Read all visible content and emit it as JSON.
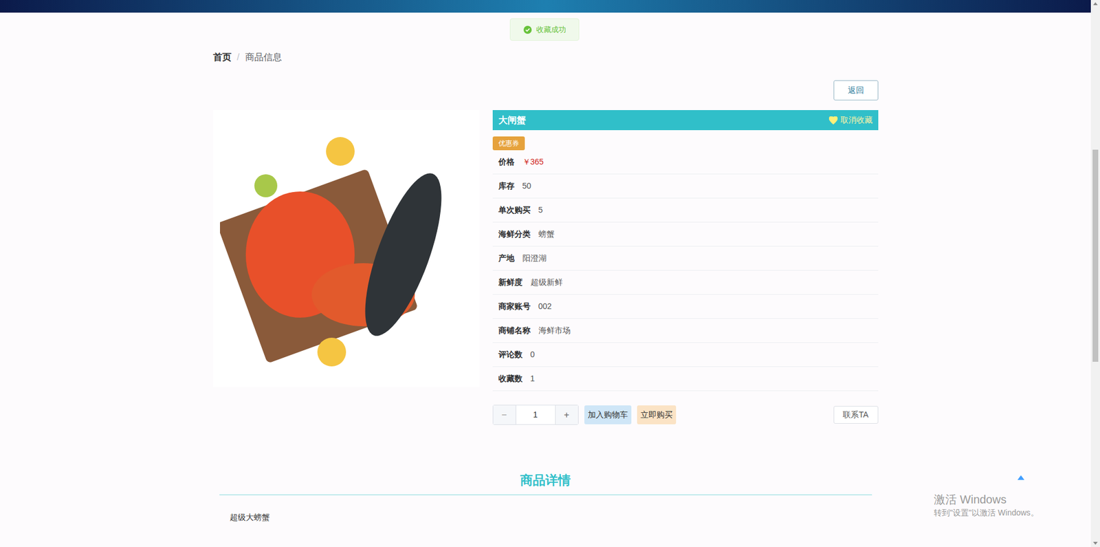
{
  "toast": {
    "text": "收藏成功"
  },
  "breadcrumb": {
    "items": [
      {
        "label": "首页",
        "current": false
      },
      {
        "label": "商品信息",
        "current": true
      }
    ],
    "separator": "/"
  },
  "back_button": "返回",
  "product": {
    "name": "大闸蟹",
    "favorited": true,
    "favorite_action": "取消收藏",
    "coupon": "优惠券",
    "attributes": [
      {
        "label": "价格",
        "value": "￥365",
        "highlight": true
      },
      {
        "label": "库存",
        "value": "50",
        "highlight": false
      },
      {
        "label": "单次购买",
        "value": "5",
        "highlight": false
      },
      {
        "label": "海鲜分类",
        "value": "螃蟹",
        "highlight": false
      },
      {
        "label": "产地",
        "value": "阳澄湖",
        "highlight": false
      },
      {
        "label": "新鲜度",
        "value": "超级新鲜",
        "highlight": false
      },
      {
        "label": "商家账号",
        "value": "002",
        "highlight": false
      },
      {
        "label": "商铺名称",
        "value": "海鲜市场",
        "highlight": false
      },
      {
        "label": "评论数",
        "value": "0",
        "highlight": false
      },
      {
        "label": "收藏数",
        "value": "1",
        "highlight": false
      }
    ]
  },
  "quantity": {
    "minus": "−",
    "value": "1",
    "plus": "+"
  },
  "buttons": {
    "add_to_cart": "加入购物车",
    "buy_now": "立即购买",
    "contact": "联系TA"
  },
  "details": {
    "title": "商品详情",
    "body": "超级大螃蟹"
  },
  "watermark": {
    "title": "激活 Windows",
    "subtitle": "转到\"设置\"以激活 Windows。"
  }
}
